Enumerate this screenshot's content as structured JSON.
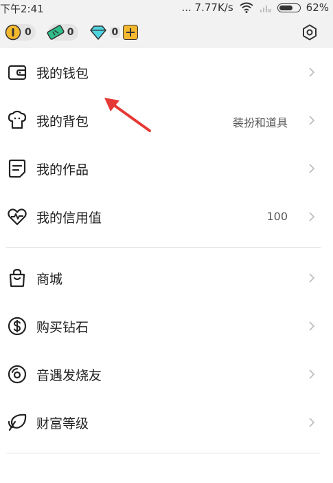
{
  "status_bar": {
    "time": "下午2:41",
    "network_speed": "... 7.77K/s",
    "battery": "62%"
  },
  "currencies": [
    {
      "name": "coin",
      "value": "0",
      "icon": "coin-icon"
    },
    {
      "name": "ticket",
      "value": "0",
      "icon": "ticket-icon"
    },
    {
      "name": "diamond",
      "value": "0",
      "icon": "diamond-icon"
    }
  ],
  "menu_group1": [
    {
      "label": "我的钱包",
      "sub": "",
      "icon": "wallet-icon"
    },
    {
      "label": "我的背包",
      "sub": "装扮和道具",
      "icon": "backpack-icon"
    },
    {
      "label": "我的作品",
      "sub": "",
      "icon": "works-icon"
    },
    {
      "label": "我的信用值",
      "sub": "100",
      "icon": "credit-heart-icon"
    }
  ],
  "menu_group2": [
    {
      "label": "商城",
      "sub": "",
      "icon": "shopping-bag-icon"
    },
    {
      "label": "购买钻石",
      "sub": "",
      "icon": "dollar-icon"
    },
    {
      "label": "音遇发烧友",
      "sub": "",
      "icon": "music-disc-icon"
    },
    {
      "label": "财富等级",
      "sub": "",
      "icon": "leaf-icon"
    }
  ],
  "colors": {
    "header_bg": "#f2f2f2",
    "coin_yellow": "#f5b92e",
    "ticket_green": "#2fbf8a",
    "diamond_cyan": "#4fd3e0",
    "annotation_arrow": "#e53935"
  }
}
